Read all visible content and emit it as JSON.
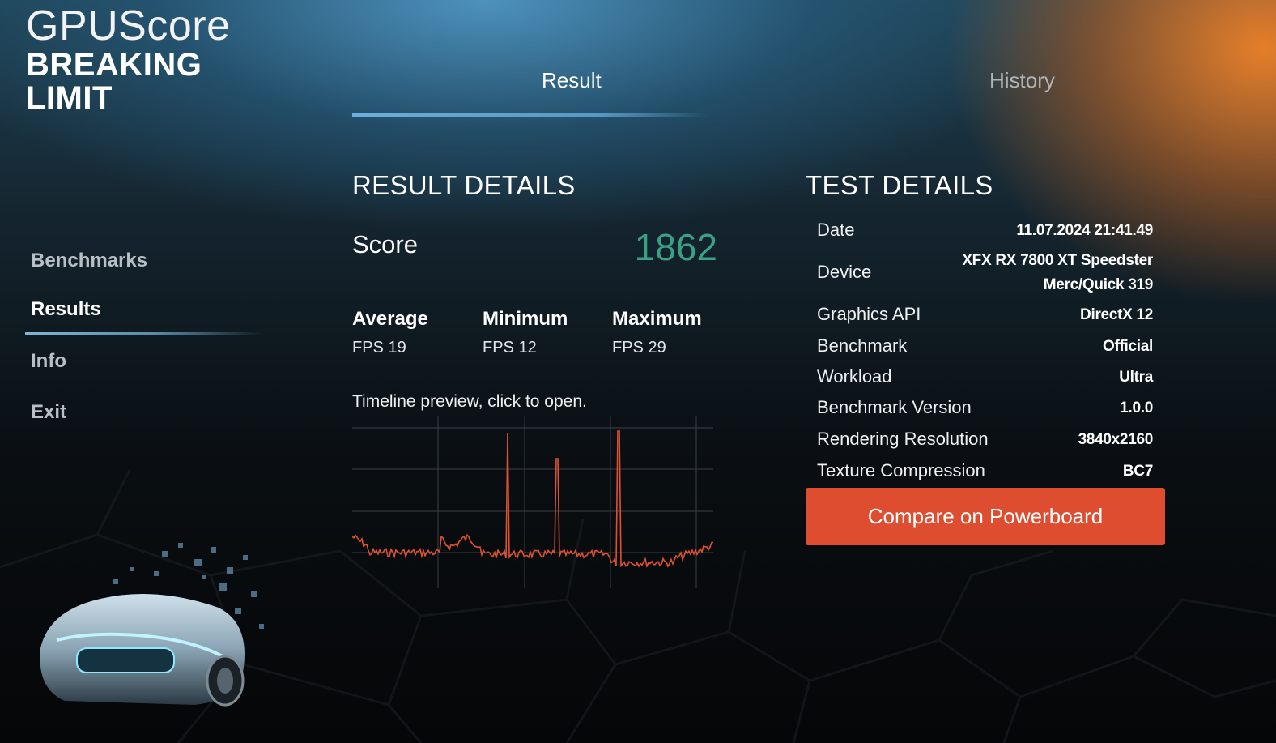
{
  "app": {
    "logo_line1": "GPUScore",
    "logo_line2": "BREAKING",
    "logo_line3": "LIMIT"
  },
  "sidebar": {
    "items": [
      {
        "label": "Benchmarks",
        "active": false
      },
      {
        "label": "Results",
        "active": true
      },
      {
        "label": "Info",
        "active": false
      },
      {
        "label": "Exit",
        "active": false
      }
    ]
  },
  "tabs": [
    {
      "label": "Result",
      "active": true
    },
    {
      "label": "History",
      "active": false
    }
  ],
  "result_details": {
    "heading": "RESULT DETAILS",
    "score_label": "Score",
    "score_value": "1862",
    "stats": [
      {
        "title": "Average",
        "value": "FPS 19"
      },
      {
        "title": "Minimum",
        "value": "FPS 12"
      },
      {
        "title": "Maximum",
        "value": "FPS 29"
      }
    ],
    "timeline_label": "Timeline preview, click to open."
  },
  "test_details": {
    "heading": "TEST DETAILS",
    "rows": [
      {
        "label": "Date",
        "value": "11.07.2024 21:41.49"
      },
      {
        "label": "Device",
        "value_line1": "XFX RX 7800 XT Speedster",
        "value_line2": "Merc/Quick 319"
      },
      {
        "label": "Graphics API",
        "value": "DirectX 12"
      },
      {
        "label": "Benchmark",
        "value": "Official"
      },
      {
        "label": "Workload",
        "value": "Ultra"
      },
      {
        "label": "Benchmark Version",
        "value": "1.0.0"
      },
      {
        "label": "Rendering Resolution",
        "value": "3840x2160"
      },
      {
        "label": "Texture Compression",
        "value": "BC7"
      }
    ],
    "compare_button": "Compare on Powerboard"
  },
  "colors": {
    "score": "#3aa184",
    "timeline": "#e0522f",
    "button": "#de4d30",
    "accent_underline": "#6ab0dc"
  }
}
